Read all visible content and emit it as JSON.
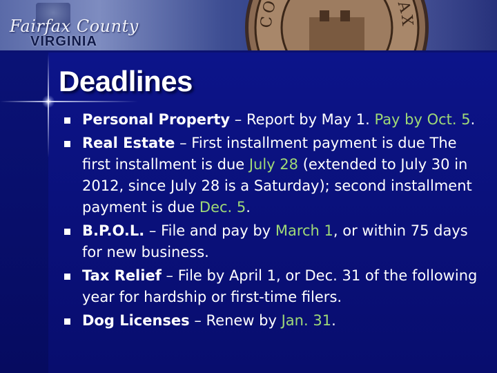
{
  "header": {
    "logo_line1": "Fairfax County",
    "logo_line2": "VIRGINIA",
    "seal_text": "COUNTY OF FAIRFAX"
  },
  "title": "Deadlines",
  "bullets": [
    {
      "term": "Personal Property",
      "parts": [
        {
          "text": " – Report by May 1. ",
          "hl": false
        },
        {
          "text": "Pay by Oct. 5",
          "hl": true
        },
        {
          "text": ".",
          "hl": false
        }
      ]
    },
    {
      "term": "Real Estate",
      "parts": [
        {
          "text": " – First installment payment is due The first installment is due ",
          "hl": false
        },
        {
          "text": "July 28",
          "hl": true
        },
        {
          "text": " (extended to July 30 in 2012, since July 28 is a Saturday); second installment payment is due ",
          "hl": false
        },
        {
          "text": "Dec. 5",
          "hl": true
        },
        {
          "text": ".",
          "hl": false
        }
      ]
    },
    {
      "term": "B.P.O.L.",
      "parts": [
        {
          "text": " – File and pay by ",
          "hl": false
        },
        {
          "text": "March 1",
          "hl": true
        },
        {
          "text": ", or within 75 days for new business.",
          "hl": false
        }
      ]
    },
    {
      "term": "Tax Relief",
      "parts": [
        {
          "text": " – File by April 1, or Dec. 31 of the following year for hardship or first-time filers.",
          "hl": false
        }
      ]
    },
    {
      "term": "Dog Licenses",
      "parts": [
        {
          "text": " – Renew by ",
          "hl": false
        },
        {
          "text": "Jan. 31",
          "hl": true
        },
        {
          "text": ".",
          "hl": false
        }
      ]
    }
  ],
  "colors": {
    "background": "#0b1280",
    "highlight": "#9fd977",
    "text": "#ffffff"
  }
}
